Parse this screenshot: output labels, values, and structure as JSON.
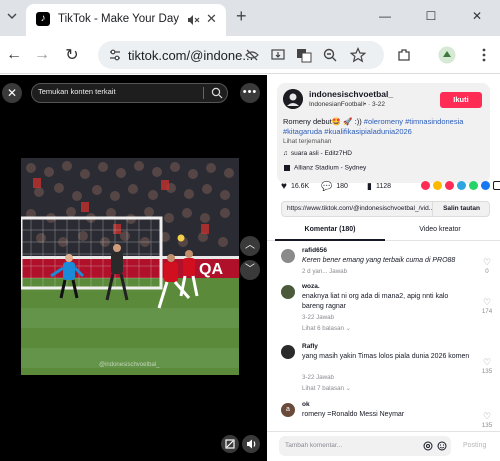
{
  "browser": {
    "tab_title": "TikTok - Make Your Day",
    "url": "tiktok.com/@indone...",
    "new_tab_glyph": "+",
    "icons": [
      "tab-search-icon",
      "tiktok-favicon",
      "tab-mute-icon",
      "close-icon",
      "minimize-icon",
      "maximize-icon",
      "back-icon",
      "forward-icon",
      "reload-icon",
      "site-info-icon",
      "eye-off-icon",
      "install-icon",
      "translate-icon",
      "zoom-icon",
      "bookmark-star-icon",
      "extensions-icon",
      "profile-icon",
      "menu-icon"
    ]
  },
  "video": {
    "search_placeholder": "Temukan konten terkait",
    "watermark": "@indonesischvoetbal_",
    "colors": {
      "background": "#000000",
      "pitch": "#5a8a3a",
      "crowd": "#2b2b33",
      "banner": "#b0102a",
      "jersey": "#d10f1f",
      "keeper": "#1a8ad9"
    }
  },
  "post": {
    "author": "indonesischvoetbal_",
    "author_sub": "IndonesianFootball• · 3-22",
    "follow_label": "Ikuti",
    "caption_text": "Romeny debut🤩 🚀 :))",
    "caption_tags_1": "#oleromeny #timnasindonesia",
    "caption_tags_2": "#kitagaruda #kualifikasipialadunia2026",
    "translate_label": "Lihat terjemahan",
    "music": "suara asli - Editz7HD",
    "location": "Allianz Stadium - Sydney",
    "likes": "16.6K",
    "comments": "180",
    "bookmarks": "1128",
    "share_colors": [
      "#fe2c55",
      "#ffb800",
      "#fe2c55",
      "#2ca5e0",
      "#25d366",
      "#1877f2",
      "#161823"
    ],
    "link": "https://www.tiktok.com/@indonesischvoetbal_/vid...",
    "copy_label": "Salin tautan",
    "tab_comments": "Komentar (180)",
    "tab_creator": "Video kreator"
  },
  "comments": [
    {
      "user": "rafid656",
      "text": "Keren bener emang yang terbaik cuma di PRO88",
      "meta": "2 d yan...   Jawab",
      "likes": "0",
      "avatar": "#8a8a8a",
      "italic": true
    },
    {
      "user": "woza.",
      "text": "enaknya liat ni org ada di mana2, apig nnti kalo bareng ragnar",
      "meta": "3-22      Jawab",
      "replies": "Lihat 6 balasan ⌄",
      "likes": "174",
      "avatar": "#4a5a3a"
    },
    {
      "user": "Rafly",
      "text": "yang masih yakin Timas lolos piala dunia 2026 komen",
      "meta": "3-22      Jawab",
      "replies": "Lihat 7 balasan ⌄",
      "likes": "135",
      "avatar": "#2a2a2a"
    },
    {
      "user": "ok",
      "text": "romeny =Ronaldo Messi Neymar",
      "meta": "",
      "likes": "135",
      "avatar": "#6a4a3a",
      "avatar_letter": "a"
    }
  ],
  "composer": {
    "placeholder": "Tambah komentar...",
    "post_label": "Posting"
  }
}
